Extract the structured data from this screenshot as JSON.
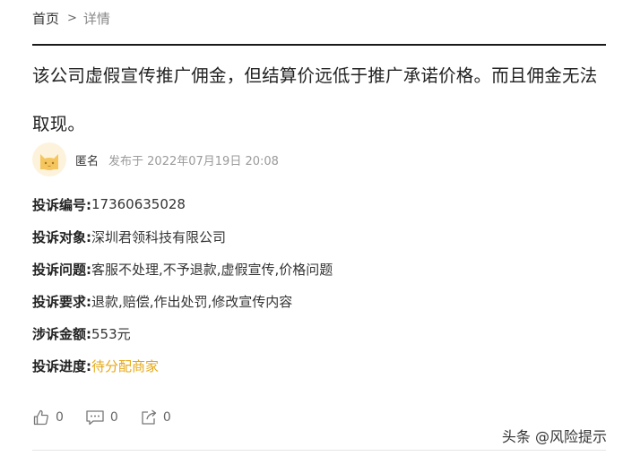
{
  "breadcrumb": {
    "home": "首页",
    "separator": ">",
    "current": "详情"
  },
  "complaint": {
    "content": "该公司虚假宣传推广佣金，但结算价远低于推广承诺价格。而且佣金无法取现。"
  },
  "meta": {
    "avatar_icon": "cat-avatar-icon",
    "author": "匿名",
    "posted_at": "发布于 2022年07月19日 20:08"
  },
  "fields": [
    {
      "label": "投诉编号:",
      "value": "17360635028"
    },
    {
      "label": "投诉对象:",
      "value": "深圳君领科技有限公司"
    },
    {
      "label": "投诉问题:",
      "value": "客服不处理,不予退款,虚假宣传,价格问题"
    },
    {
      "label": "投诉要求:",
      "value": "退款,赔偿,作出处罚,修改宣传内容"
    },
    {
      "label": "涉诉金额:",
      "value": "553元"
    },
    {
      "label": "投诉进度:",
      "value": "待分配商家"
    }
  ],
  "actions": {
    "like_icon": "thumbs-up-icon",
    "like_count": "0",
    "comment_icon": "comment-icon",
    "comment_count": "0",
    "share_icon": "share-icon",
    "share_count": "0"
  },
  "watermark": {
    "text": "头条 @风险提示"
  },
  "colors": {
    "pending_status": "#e6a817",
    "avatar_bg": "#fdf3dc",
    "avatar_face": "#f5c65e"
  }
}
